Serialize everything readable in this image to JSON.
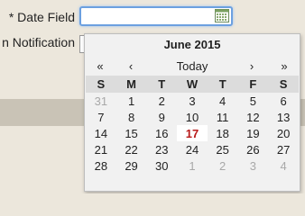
{
  "form": {
    "date_label": "* Date Field",
    "date_value": "",
    "notification_label": "n Notification"
  },
  "icons": {
    "calendar": "calendar-icon"
  },
  "calendar": {
    "month_title": "June 2015",
    "nav": {
      "prev_year": "«",
      "prev_month": "‹",
      "today": "Today",
      "next_month": "›",
      "next_year": "»"
    },
    "weekdays": [
      "S",
      "M",
      "T",
      "W",
      "T",
      "F",
      "S"
    ],
    "weeks": [
      [
        {
          "d": "31",
          "other": true
        },
        {
          "d": "1"
        },
        {
          "d": "2"
        },
        {
          "d": "3"
        },
        {
          "d": "4"
        },
        {
          "d": "5"
        },
        {
          "d": "6"
        }
      ],
      [
        {
          "d": "7"
        },
        {
          "d": "8"
        },
        {
          "d": "9"
        },
        {
          "d": "10"
        },
        {
          "d": "11"
        },
        {
          "d": "12"
        },
        {
          "d": "13"
        }
      ],
      [
        {
          "d": "14"
        },
        {
          "d": "15"
        },
        {
          "d": "16"
        },
        {
          "d": "17",
          "today": true
        },
        {
          "d": "18"
        },
        {
          "d": "19"
        },
        {
          "d": "20"
        }
      ],
      [
        {
          "d": "21"
        },
        {
          "d": "22"
        },
        {
          "d": "23"
        },
        {
          "d": "24"
        },
        {
          "d": "25"
        },
        {
          "d": "26"
        },
        {
          "d": "27"
        }
      ],
      [
        {
          "d": "28"
        },
        {
          "d": "29"
        },
        {
          "d": "30"
        },
        {
          "d": "1",
          "other": true
        },
        {
          "d": "2",
          "other": true
        },
        {
          "d": "3",
          "other": true
        },
        {
          "d": "4",
          "other": true
        }
      ]
    ],
    "colors": {
      "today_text": "#b81a1a",
      "other_month_text": "#a8a8a8",
      "header_bg": "#dcdcdc"
    }
  }
}
